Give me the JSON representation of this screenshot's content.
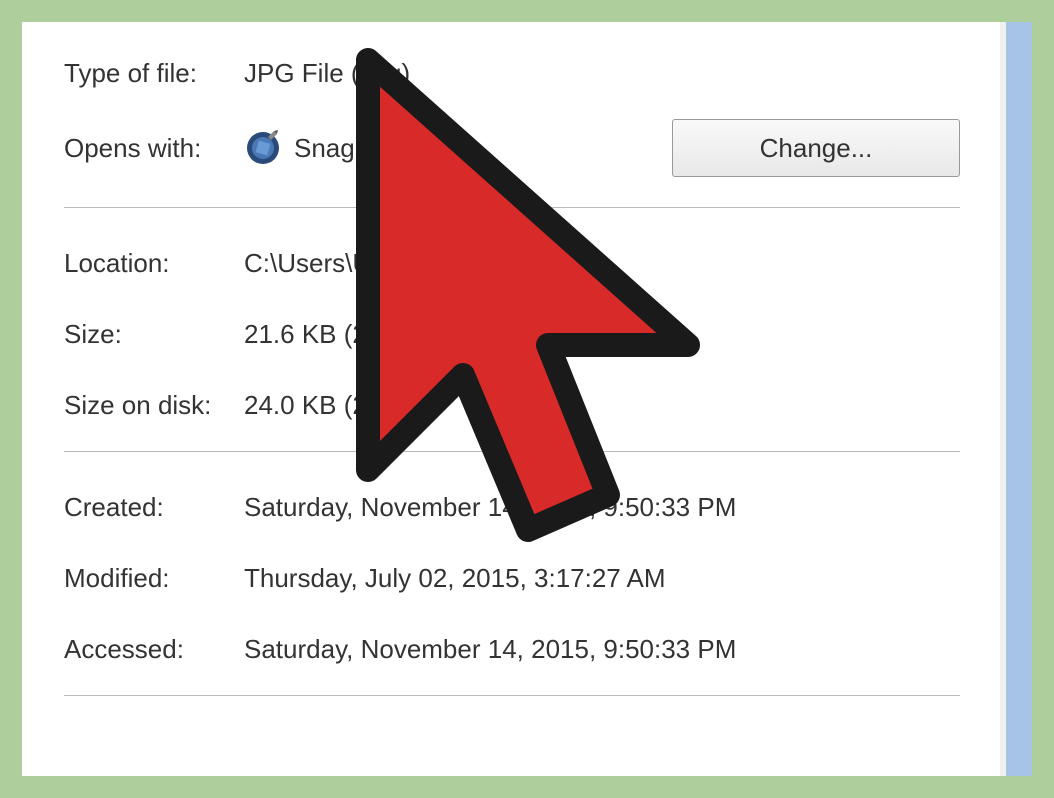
{
  "properties": {
    "type_of_file": {
      "label": "Type of file:",
      "value": "JPG File (.jpg)"
    },
    "opens_with": {
      "label": "Opens with:",
      "app_name": "Snagit  "
    },
    "change_button": "Change...",
    "location": {
      "label": "Location:",
      "value": "C:\\Users\\Us"
    },
    "size": {
      "label": "Size:",
      "value": "21.6 KB (22"
    },
    "size_on_disk": {
      "label": "Size on disk:",
      "value": "24.0 KB (24        byte"
    },
    "created": {
      "label": "Created:",
      "value": "Saturday, November 14, 2015, 9:50:33 PM"
    },
    "modified": {
      "label": "Modified:",
      "value": "Thursday, July 02, 2015, 3:17:27 AM"
    },
    "accessed": {
      "label": "Accessed:",
      "value": "Saturday, November 14, 2015, 9:50:33 PM"
    }
  }
}
